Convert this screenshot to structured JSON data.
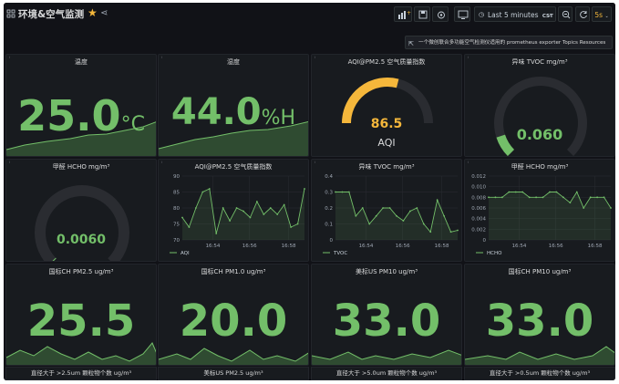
{
  "header": {
    "title": "环境&空气监测",
    "time_range": "Last 5 minutes",
    "timezone": "CST",
    "refresh": "5s"
  },
  "link_bar": {
    "text": "一个微创联合多功能空气检测仪适用的 prometheus exporter Topics Resources"
  },
  "panels": {
    "temp": {
      "title": "温度",
      "value": "25.0",
      "unit": "°C"
    },
    "humidity": {
      "title": "湿度",
      "value": "44.0",
      "unit": "%H"
    },
    "aqi_gauge": {
      "title": "AQI@PM2.5 空气质量指数",
      "value": "86.5",
      "sub": "AQI",
      "level": 0.58,
      "color": "#f5b73b"
    },
    "tvoc_gauge": {
      "title": "异味 TVOC mg/m³",
      "value": "0.060",
      "level": 0.1,
      "color": "#73bf69"
    },
    "hcho_gauge": {
      "title": "甲醛 HCHO mg/m³",
      "value": "0.0060",
      "level": 0.0,
      "color": "#73bf69"
    },
    "aqi_chart": {
      "title": "AQI@PM2.5 空气质量指数"
    },
    "tvoc_chart": {
      "title": "异味 TVOC mg/m³"
    },
    "hcho_chart": {
      "title": "甲醛 HCHO mg/m³"
    },
    "pm25_cn": {
      "title": "国标CH PM2.5 ug/m³",
      "value": "25.5"
    },
    "pm10_cn": {
      "title": "国标CH PM1.0 ug/m³",
      "value": "20.0"
    },
    "pm10_us": {
      "title": "美标US PM10 ug/m³",
      "value": "33.0"
    },
    "pm10_ch": {
      "title": "国标CH PM10 ug/m³",
      "value": "33.0"
    }
  },
  "bottom": {
    "b1": "直径大于 >2.5um 颗粒物个数 ug/m³",
    "b2": "美标US PM2.5 ug/m³",
    "b3": "直径大于 >5.0um 颗粒物个数 ug/m³",
    "b4": "直径大于 >0.5um 颗粒物个数 ug/m³"
  },
  "chart_data": [
    {
      "type": "line",
      "x": [
        "16:54",
        "16:56",
        "16:58"
      ],
      "series": [
        {
          "name": "AQI",
          "values": [
            77,
            74,
            80,
            85,
            86,
            72,
            80,
            76,
            80,
            79,
            77,
            82,
            78,
            80,
            78,
            81,
            74,
            75,
            86
          ]
        }
      ],
      "yticks": [
        "70",
        "75",
        "80",
        "85",
        "90"
      ],
      "ylim": [
        70,
        90
      ]
    },
    {
      "type": "line",
      "x": [
        "16:54",
        "16:56",
        "16:58"
      ],
      "series": [
        {
          "name": "TVOC",
          "values": [
            0.3,
            0.3,
            0.3,
            0.15,
            0.2,
            0.1,
            0.15,
            0.2,
            0.2,
            0.15,
            0.12,
            0.18,
            0.2,
            0.1,
            0.05,
            0.25,
            0.15,
            0.05,
            0.06
          ]
        }
      ],
      "yticks": [
        "0",
        "0.1",
        "0.2",
        "0.3",
        "0.4"
      ],
      "ylim": [
        0,
        0.4
      ]
    },
    {
      "type": "line",
      "x": [
        "16:54",
        "16:56",
        "16:58"
      ],
      "series": [
        {
          "name": "HCHO",
          "values": [
            0.008,
            0.008,
            0.008,
            0.009,
            0.009,
            0.009,
            0.008,
            0.008,
            0.008,
            0.009,
            0.009,
            0.008,
            0.007,
            0.009,
            0.006,
            0.008,
            0.008,
            0.008,
            0.006
          ]
        }
      ],
      "yticks": [
        "0",
        "0.002",
        "0.004",
        "0.006",
        "0.008",
        "0.010",
        "0.012"
      ],
      "ylim": [
        0,
        0.012
      ]
    }
  ]
}
